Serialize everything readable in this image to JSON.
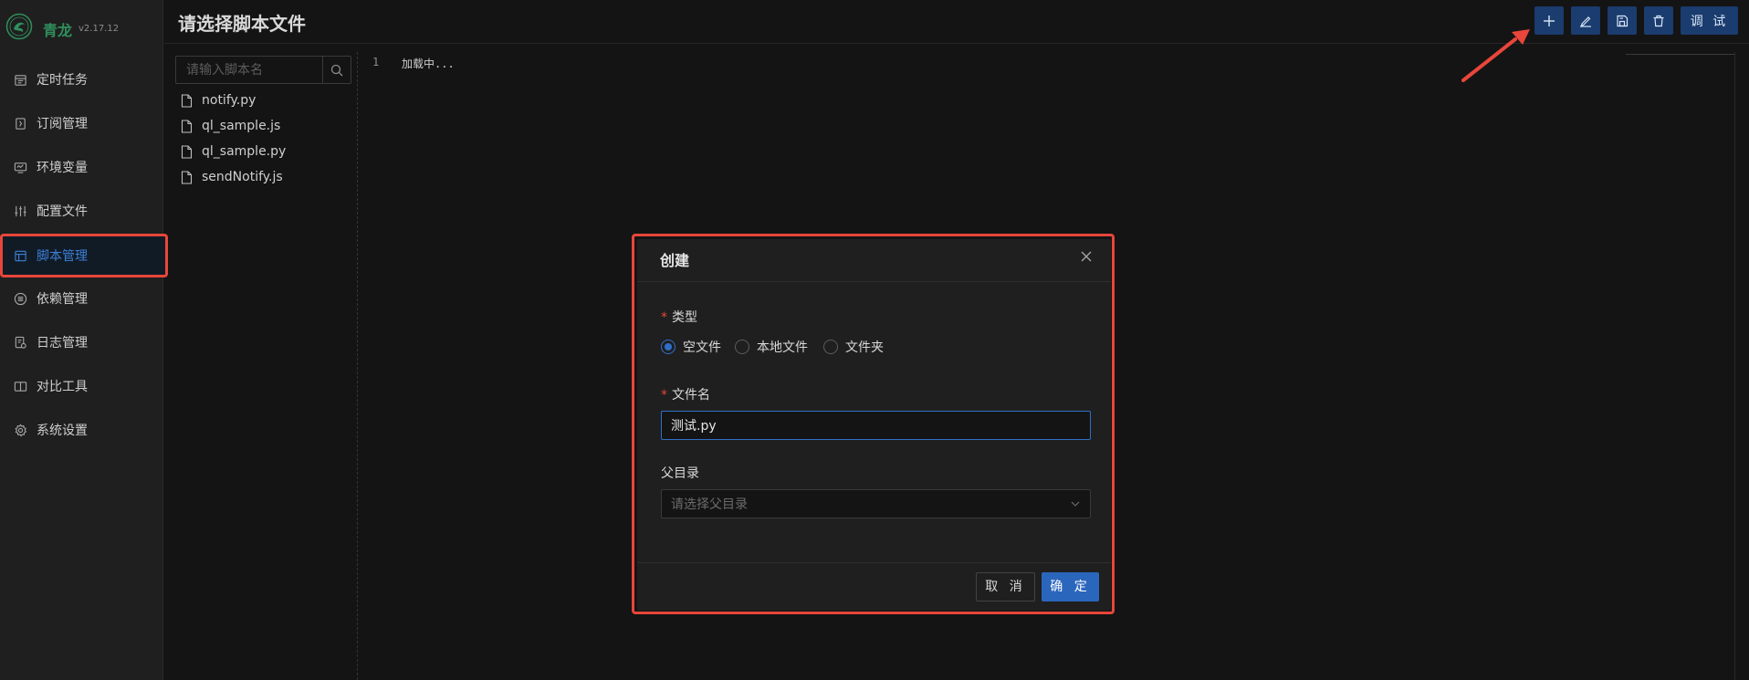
{
  "app": {
    "name": "青龙",
    "version": "v2.17.12"
  },
  "page": {
    "title": "请选择脚本文件"
  },
  "sidebar": {
    "items": [
      {
        "label": "定时任务",
        "icon": "calendar-icon"
      },
      {
        "label": "订阅管理",
        "icon": "subscription-icon"
      },
      {
        "label": "环境变量",
        "icon": "monitor-icon"
      },
      {
        "label": "配置文件",
        "icon": "sliders-icon"
      },
      {
        "label": "脚本管理",
        "icon": "layout-icon",
        "active": true
      },
      {
        "label": "依赖管理",
        "icon": "list-circle-icon"
      },
      {
        "label": "日志管理",
        "icon": "log-icon"
      },
      {
        "label": "对比工具",
        "icon": "compare-icon"
      },
      {
        "label": "系统设置",
        "icon": "gear-icon"
      }
    ]
  },
  "toolbar": {
    "buttons": [
      "plus-icon",
      "edit-icon",
      "save-icon",
      "delete-icon"
    ],
    "debug_label": "调 试"
  },
  "tree": {
    "search_placeholder": "请输入脚本名",
    "files": [
      "notify.py",
      "ql_sample.js",
      "ql_sample.py",
      "sendNotify.js"
    ]
  },
  "editor": {
    "line_number": "1",
    "content": "加载中..."
  },
  "modal": {
    "title": "创建",
    "type_label": "类型",
    "type_options": [
      "空文件",
      "本地文件",
      "文件夹"
    ],
    "type_selected": "空文件",
    "filename_label": "文件名",
    "filename_value": "测试.py",
    "parent_label": "父目录",
    "parent_placeholder": "请选择父目录",
    "cancel_label": "取 消",
    "ok_label": "确 定"
  },
  "colors": {
    "accent": "#2b66bd",
    "annotation": "#e8463a",
    "brand_green": "#2f8f5c",
    "background": "#141414"
  }
}
